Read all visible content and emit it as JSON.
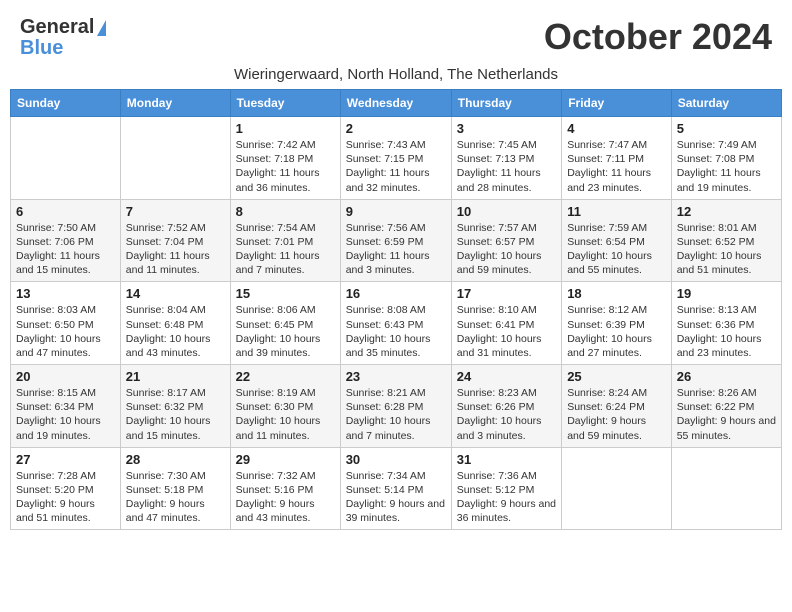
{
  "header": {
    "logo_line1": "General",
    "logo_line2": "Blue",
    "month": "October 2024",
    "location": "Wieringerwaard, North Holland, The Netherlands"
  },
  "weekdays": [
    "Sunday",
    "Monday",
    "Tuesday",
    "Wednesday",
    "Thursday",
    "Friday",
    "Saturday"
  ],
  "weeks": [
    [
      {
        "day": "",
        "sunrise": "",
        "sunset": "",
        "daylight": ""
      },
      {
        "day": "",
        "sunrise": "",
        "sunset": "",
        "daylight": ""
      },
      {
        "day": "1",
        "sunrise": "Sunrise: 7:42 AM",
        "sunset": "Sunset: 7:18 PM",
        "daylight": "Daylight: 11 hours and 36 minutes."
      },
      {
        "day": "2",
        "sunrise": "Sunrise: 7:43 AM",
        "sunset": "Sunset: 7:15 PM",
        "daylight": "Daylight: 11 hours and 32 minutes."
      },
      {
        "day": "3",
        "sunrise": "Sunrise: 7:45 AM",
        "sunset": "Sunset: 7:13 PM",
        "daylight": "Daylight: 11 hours and 28 minutes."
      },
      {
        "day": "4",
        "sunrise": "Sunrise: 7:47 AM",
        "sunset": "Sunset: 7:11 PM",
        "daylight": "Daylight: 11 hours and 23 minutes."
      },
      {
        "day": "5",
        "sunrise": "Sunrise: 7:49 AM",
        "sunset": "Sunset: 7:08 PM",
        "daylight": "Daylight: 11 hours and 19 minutes."
      }
    ],
    [
      {
        "day": "6",
        "sunrise": "Sunrise: 7:50 AM",
        "sunset": "Sunset: 7:06 PM",
        "daylight": "Daylight: 11 hours and 15 minutes."
      },
      {
        "day": "7",
        "sunrise": "Sunrise: 7:52 AM",
        "sunset": "Sunset: 7:04 PM",
        "daylight": "Daylight: 11 hours and 11 minutes."
      },
      {
        "day": "8",
        "sunrise": "Sunrise: 7:54 AM",
        "sunset": "Sunset: 7:01 PM",
        "daylight": "Daylight: 11 hours and 7 minutes."
      },
      {
        "day": "9",
        "sunrise": "Sunrise: 7:56 AM",
        "sunset": "Sunset: 6:59 PM",
        "daylight": "Daylight: 11 hours and 3 minutes."
      },
      {
        "day": "10",
        "sunrise": "Sunrise: 7:57 AM",
        "sunset": "Sunset: 6:57 PM",
        "daylight": "Daylight: 10 hours and 59 minutes."
      },
      {
        "day": "11",
        "sunrise": "Sunrise: 7:59 AM",
        "sunset": "Sunset: 6:54 PM",
        "daylight": "Daylight: 10 hours and 55 minutes."
      },
      {
        "day": "12",
        "sunrise": "Sunrise: 8:01 AM",
        "sunset": "Sunset: 6:52 PM",
        "daylight": "Daylight: 10 hours and 51 minutes."
      }
    ],
    [
      {
        "day": "13",
        "sunrise": "Sunrise: 8:03 AM",
        "sunset": "Sunset: 6:50 PM",
        "daylight": "Daylight: 10 hours and 47 minutes."
      },
      {
        "day": "14",
        "sunrise": "Sunrise: 8:04 AM",
        "sunset": "Sunset: 6:48 PM",
        "daylight": "Daylight: 10 hours and 43 minutes."
      },
      {
        "day": "15",
        "sunrise": "Sunrise: 8:06 AM",
        "sunset": "Sunset: 6:45 PM",
        "daylight": "Daylight: 10 hours and 39 minutes."
      },
      {
        "day": "16",
        "sunrise": "Sunrise: 8:08 AM",
        "sunset": "Sunset: 6:43 PM",
        "daylight": "Daylight: 10 hours and 35 minutes."
      },
      {
        "day": "17",
        "sunrise": "Sunrise: 8:10 AM",
        "sunset": "Sunset: 6:41 PM",
        "daylight": "Daylight: 10 hours and 31 minutes."
      },
      {
        "day": "18",
        "sunrise": "Sunrise: 8:12 AM",
        "sunset": "Sunset: 6:39 PM",
        "daylight": "Daylight: 10 hours and 27 minutes."
      },
      {
        "day": "19",
        "sunrise": "Sunrise: 8:13 AM",
        "sunset": "Sunset: 6:36 PM",
        "daylight": "Daylight: 10 hours and 23 minutes."
      }
    ],
    [
      {
        "day": "20",
        "sunrise": "Sunrise: 8:15 AM",
        "sunset": "Sunset: 6:34 PM",
        "daylight": "Daylight: 10 hours and 19 minutes."
      },
      {
        "day": "21",
        "sunrise": "Sunrise: 8:17 AM",
        "sunset": "Sunset: 6:32 PM",
        "daylight": "Daylight: 10 hours and 15 minutes."
      },
      {
        "day": "22",
        "sunrise": "Sunrise: 8:19 AM",
        "sunset": "Sunset: 6:30 PM",
        "daylight": "Daylight: 10 hours and 11 minutes."
      },
      {
        "day": "23",
        "sunrise": "Sunrise: 8:21 AM",
        "sunset": "Sunset: 6:28 PM",
        "daylight": "Daylight: 10 hours and 7 minutes."
      },
      {
        "day": "24",
        "sunrise": "Sunrise: 8:23 AM",
        "sunset": "Sunset: 6:26 PM",
        "daylight": "Daylight: 10 hours and 3 minutes."
      },
      {
        "day": "25",
        "sunrise": "Sunrise: 8:24 AM",
        "sunset": "Sunset: 6:24 PM",
        "daylight": "Daylight: 9 hours and 59 minutes."
      },
      {
        "day": "26",
        "sunrise": "Sunrise: 8:26 AM",
        "sunset": "Sunset: 6:22 PM",
        "daylight": "Daylight: 9 hours and 55 minutes."
      }
    ],
    [
      {
        "day": "27",
        "sunrise": "Sunrise: 7:28 AM",
        "sunset": "Sunset: 5:20 PM",
        "daylight": "Daylight: 9 hours and 51 minutes."
      },
      {
        "day": "28",
        "sunrise": "Sunrise: 7:30 AM",
        "sunset": "Sunset: 5:18 PM",
        "daylight": "Daylight: 9 hours and 47 minutes."
      },
      {
        "day": "29",
        "sunrise": "Sunrise: 7:32 AM",
        "sunset": "Sunset: 5:16 PM",
        "daylight": "Daylight: 9 hours and 43 minutes."
      },
      {
        "day": "30",
        "sunrise": "Sunrise: 7:34 AM",
        "sunset": "Sunset: 5:14 PM",
        "daylight": "Daylight: 9 hours and 39 minutes."
      },
      {
        "day": "31",
        "sunrise": "Sunrise: 7:36 AM",
        "sunset": "Sunset: 5:12 PM",
        "daylight": "Daylight: 9 hours and 36 minutes."
      },
      {
        "day": "",
        "sunrise": "",
        "sunset": "",
        "daylight": ""
      },
      {
        "day": "",
        "sunrise": "",
        "sunset": "",
        "daylight": ""
      }
    ]
  ]
}
